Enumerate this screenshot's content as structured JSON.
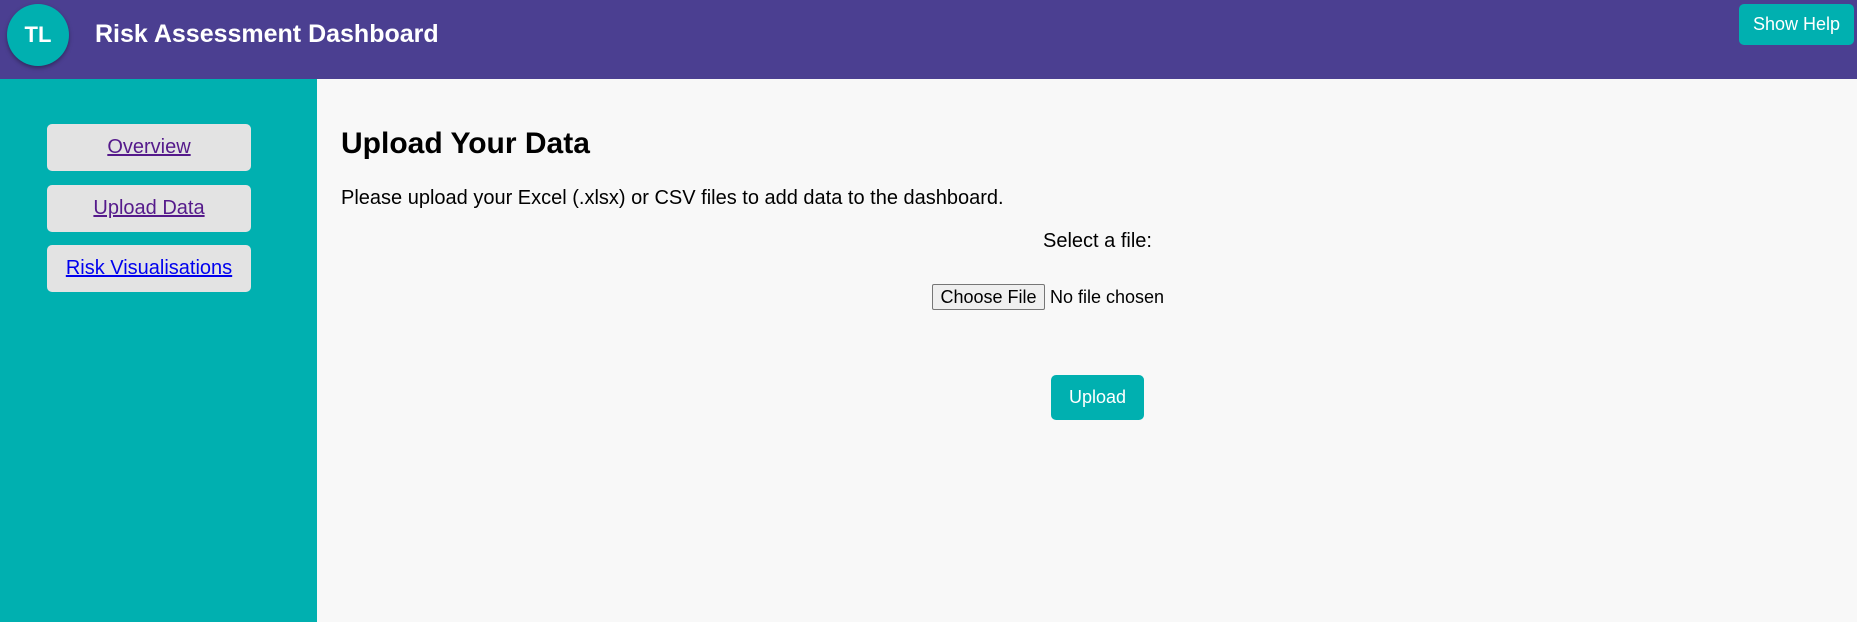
{
  "header": {
    "avatar_initials": "TL",
    "title": "Risk Assessment Dashboard",
    "help_button_label": "Show Help"
  },
  "sidebar": {
    "items": [
      {
        "label": "Overview",
        "visited": true
      },
      {
        "label": "Upload Data",
        "visited": true
      },
      {
        "label": "Risk Visualisations",
        "visited": false
      }
    ]
  },
  "main": {
    "title": "Upload Your Data",
    "instructions": "Please upload your Excel (.xlsx) or CSV files to add data to the dashboard.",
    "file_label": "Select a file:",
    "choose_file_label": "Choose File",
    "file_status": "No file chosen",
    "upload_button_label": "Upload"
  },
  "colors": {
    "header_bg": "#4b3f91",
    "accent": "#00b0b0",
    "nav_item_bg": "#e3e3e3",
    "content_bg": "#f8f8f8"
  }
}
